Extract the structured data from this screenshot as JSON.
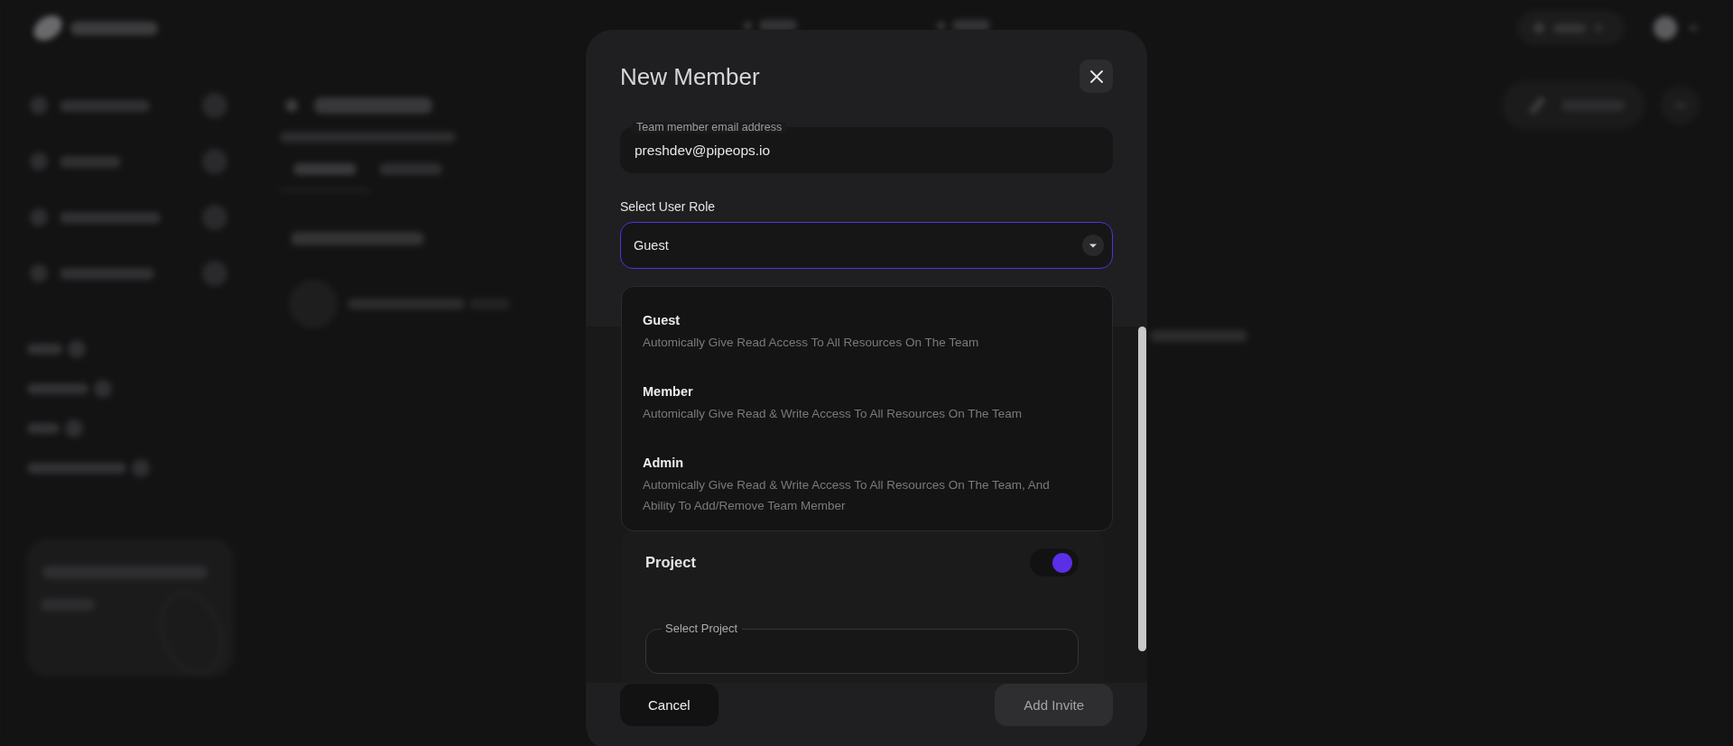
{
  "dialog": {
    "title": "New Member"
  },
  "email_field": {
    "label": "Team member email address",
    "value": "preshdev@pipeops.io"
  },
  "role_select": {
    "label": "Select User Role",
    "value": "Guest",
    "expanded": true,
    "options": [
      {
        "name": "Guest",
        "description": "Automically Give Read Access To All Resources On The Team"
      },
      {
        "name": "Member",
        "description": "Automically Give Read & Write Access To All Resources On The Team"
      },
      {
        "name": "Admin",
        "description": "Automically Give Read & Write Access To All Resources On The Team, And Ability To Add/Remove Team Member"
      }
    ]
  },
  "project_section": {
    "label": "Project",
    "on": true,
    "field": {
      "label": "Select Project"
    }
  },
  "buttons": [
    {
      "label": "Cancel",
      "kind": "secondary",
      "disabled": false
    },
    {
      "label": "Add Invite",
      "kind": "primary",
      "disabled": true
    }
  ]
}
